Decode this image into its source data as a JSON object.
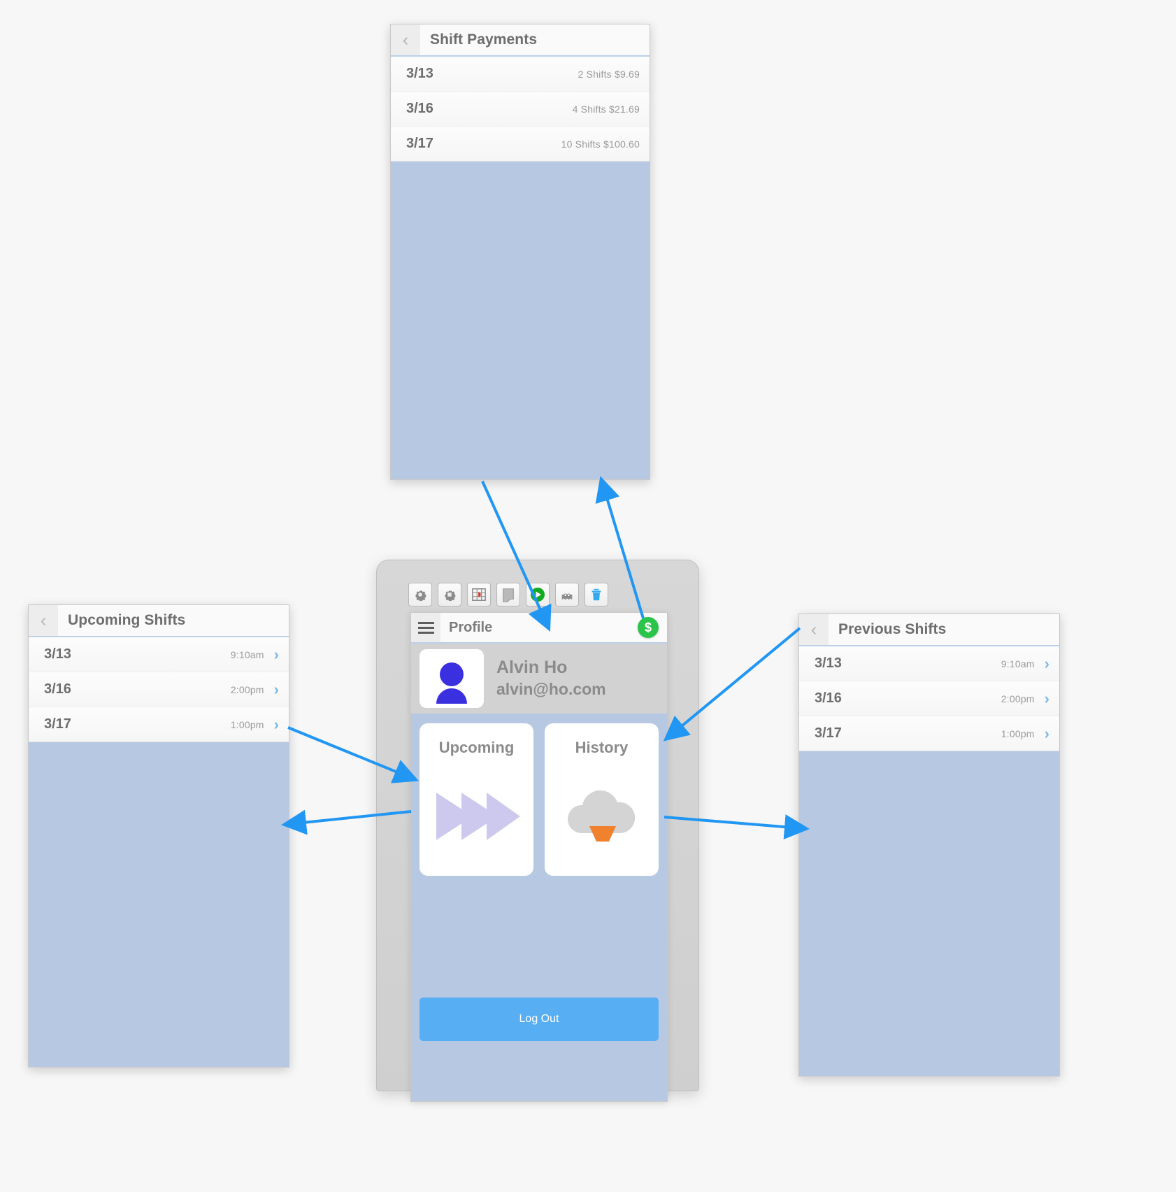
{
  "shift_payments": {
    "title": "Shift Payments",
    "back_icon": "chevron-left-icon",
    "rows": [
      {
        "date": "3/13",
        "meta": "2 Shifts $9.69"
      },
      {
        "date": "3/16",
        "meta": "4 Shifts $21.69"
      },
      {
        "date": "3/17",
        "meta": "10 Shifts $100.60"
      }
    ]
  },
  "upcoming_shifts": {
    "title": "Upcoming Shifts",
    "back_icon": "chevron-left-icon",
    "rows": [
      {
        "date": "3/13",
        "time": "9:10am",
        "chevron": "›"
      },
      {
        "date": "3/16",
        "time": "2:00pm",
        "chevron": "›"
      },
      {
        "date": "3/17",
        "time": "1:00pm",
        "chevron": "›"
      }
    ]
  },
  "previous_shifts": {
    "title": "Previous Shifts",
    "back_icon": "chevron-left-icon",
    "rows": [
      {
        "date": "3/13",
        "time": "9:10am",
        "chevron": "›"
      },
      {
        "date": "3/16",
        "time": "2:00pm",
        "chevron": "›"
      },
      {
        "date": "3/17",
        "time": "1:00pm",
        "chevron": "›"
      }
    ]
  },
  "device": {
    "toolbar": [
      {
        "name": "settings-gear-icon",
        "label": ""
      },
      {
        "name": "preferences-gear-icon",
        "label": ""
      },
      {
        "name": "grid-layout-icon",
        "label": ""
      },
      {
        "name": "duplicate-screen-icon",
        "label": ""
      },
      {
        "name": "play-preview-icon",
        "label": ""
      },
      {
        "name": "ghost-overlay-icon",
        "label": ""
      },
      {
        "name": "delete-trash-icon",
        "label": ""
      }
    ]
  },
  "phone": {
    "menu_icon": "hamburger-menu-icon",
    "title": "Profile",
    "money_badge": "$",
    "profile": {
      "name": "Alvin Ho",
      "email": "alvin@ho.com",
      "avatar_icon": "user-avatar-icon"
    },
    "cards": [
      {
        "label": "Upcoming",
        "icon": "fast-forward-icon"
      },
      {
        "label": "History",
        "icon": "cloud-upload-icon"
      }
    ],
    "logout_label": "Log Out"
  },
  "colors": {
    "screen_body": "#b6c8e2",
    "accent_blue": "#2196f3",
    "logout_blue": "#58aef2",
    "badge_green": "#2bc44a",
    "avatar_blue": "#3a30e0",
    "upcoming_purple": "#cdc9ee",
    "history_orange": "#f0812f"
  }
}
